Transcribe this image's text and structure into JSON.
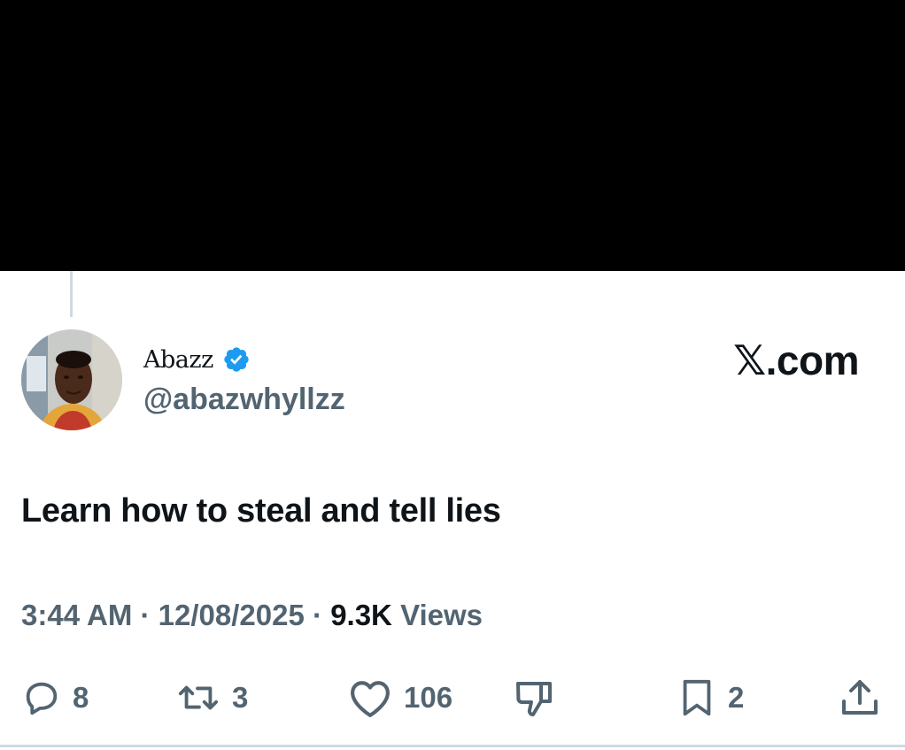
{
  "tweet": {
    "author": {
      "display_name": "Abazz",
      "handle": "@abazwhyllzz",
      "verified": true,
      "avatar": "profile-photo"
    },
    "brand": "𝕏.com",
    "text": "Learn how to steal and tell lies",
    "meta": {
      "time": "3:44 AM",
      "separator": "·",
      "date": "12/08/2025",
      "views_count": "9.3K",
      "views_label": "Views"
    },
    "actions": {
      "reply": {
        "icon": "reply-icon",
        "count": "8"
      },
      "repost": {
        "icon": "repost-icon",
        "count": "3"
      },
      "like": {
        "icon": "heart-icon",
        "count": "106"
      },
      "dislike": {
        "icon": "thumbs-down-icon"
      },
      "bookmark": {
        "icon": "bookmark-icon",
        "count": "2"
      },
      "share": {
        "icon": "share-icon"
      }
    }
  },
  "colors": {
    "text_primary": "#0f1419",
    "text_secondary": "#536471",
    "verified_blue": "#1d9bf0",
    "divider": "#cfd9de",
    "banner": "#000000"
  }
}
